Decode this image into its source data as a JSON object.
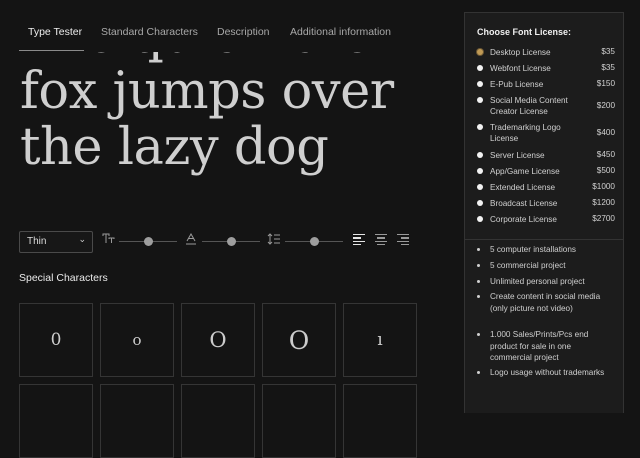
{
  "tabs": [
    {
      "label": "Type Tester",
      "active": true
    },
    {
      "label": "Standard Characters",
      "active": false
    },
    {
      "label": "Description",
      "active": false
    },
    {
      "label": "Additional information",
      "active": false
    }
  ],
  "tester": {
    "lines": [
      "The quick brown",
      "fox jumps over",
      "the lazy dog"
    ]
  },
  "controls": {
    "weight": "Thin",
    "size_level": 0.5,
    "tracking_level": 0.5,
    "leading_level": 0.5,
    "alignment": "left",
    "icons": [
      "chevron-down-icon",
      "font-size-icon",
      "letter-spacing-icon",
      "line-height-icon",
      "align-left-icon",
      "align-center-icon",
      "align-right-icon"
    ]
  },
  "special_characters": {
    "heading": "Special Characters",
    "glyphs": [
      "0",
      "o",
      "O",
      "O",
      "ı"
    ]
  },
  "license_panel": {
    "title": "Choose Font License:",
    "licenses": [
      {
        "name": "Desktop License",
        "price": "$35",
        "selected": true
      },
      {
        "name": "Webfont License",
        "price": "$35",
        "selected": false
      },
      {
        "name": "E-Pub License",
        "price": "$150",
        "selected": false
      },
      {
        "name": "Social Media Content Creator License",
        "price": "$200",
        "selected": false
      },
      {
        "name": "Trademarking Logo License",
        "price": "$400",
        "selected": false
      },
      {
        "name": "Server License",
        "price": "$450",
        "selected": false
      },
      {
        "name": "App/Game License",
        "price": "$500",
        "selected": false
      },
      {
        "name": "Extended License",
        "price": "$1000",
        "selected": false
      },
      {
        "name": "Broadcast License",
        "price": "$1200",
        "selected": false
      },
      {
        "name": "Corporate License",
        "price": "$2700",
        "selected": false
      }
    ],
    "features": [
      "5 computer installations",
      "5 commercial project",
      "Unlimited personal project",
      "Create content in social media (only picture not video)",
      "1.000 Sales/Prints/Pcs end product for sale in one commercial project",
      "Logo usage without trademarks"
    ]
  },
  "colors": {
    "background": "#141414",
    "panel": "#1c1c1c",
    "accent": "#c09a55",
    "text": "#d9d9d9"
  }
}
